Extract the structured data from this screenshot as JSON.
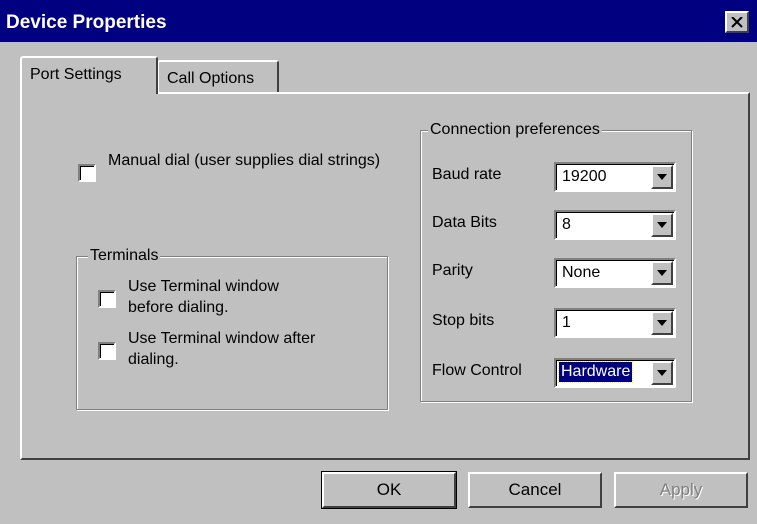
{
  "window": {
    "title": "Device Properties"
  },
  "tabs": [
    {
      "label": "Port Settings",
      "active": true
    },
    {
      "label": "Call Options",
      "active": false
    }
  ],
  "manual_dial": {
    "label": "Manual dial (user supplies dial strings)",
    "checked": false
  },
  "terminals": {
    "legend": "Terminals",
    "before_dialing": {
      "label": "Use Terminal window before dialing.",
      "checked": false
    },
    "after_dialing": {
      "label": "Use Terminal window after dialing.",
      "checked": false
    }
  },
  "connection": {
    "legend": "Connection preferences",
    "baud_rate": {
      "label": "Baud rate",
      "value": "19200"
    },
    "data_bits": {
      "label": "Data Bits",
      "value": "8"
    },
    "parity": {
      "label": "Parity",
      "value": "None"
    },
    "stop_bits": {
      "label": "Stop bits",
      "value": "1"
    },
    "flow_control": {
      "label": "Flow Control",
      "value": "Hardware"
    }
  },
  "buttons": {
    "ok": "OK",
    "cancel": "Cancel",
    "apply": "Apply"
  }
}
